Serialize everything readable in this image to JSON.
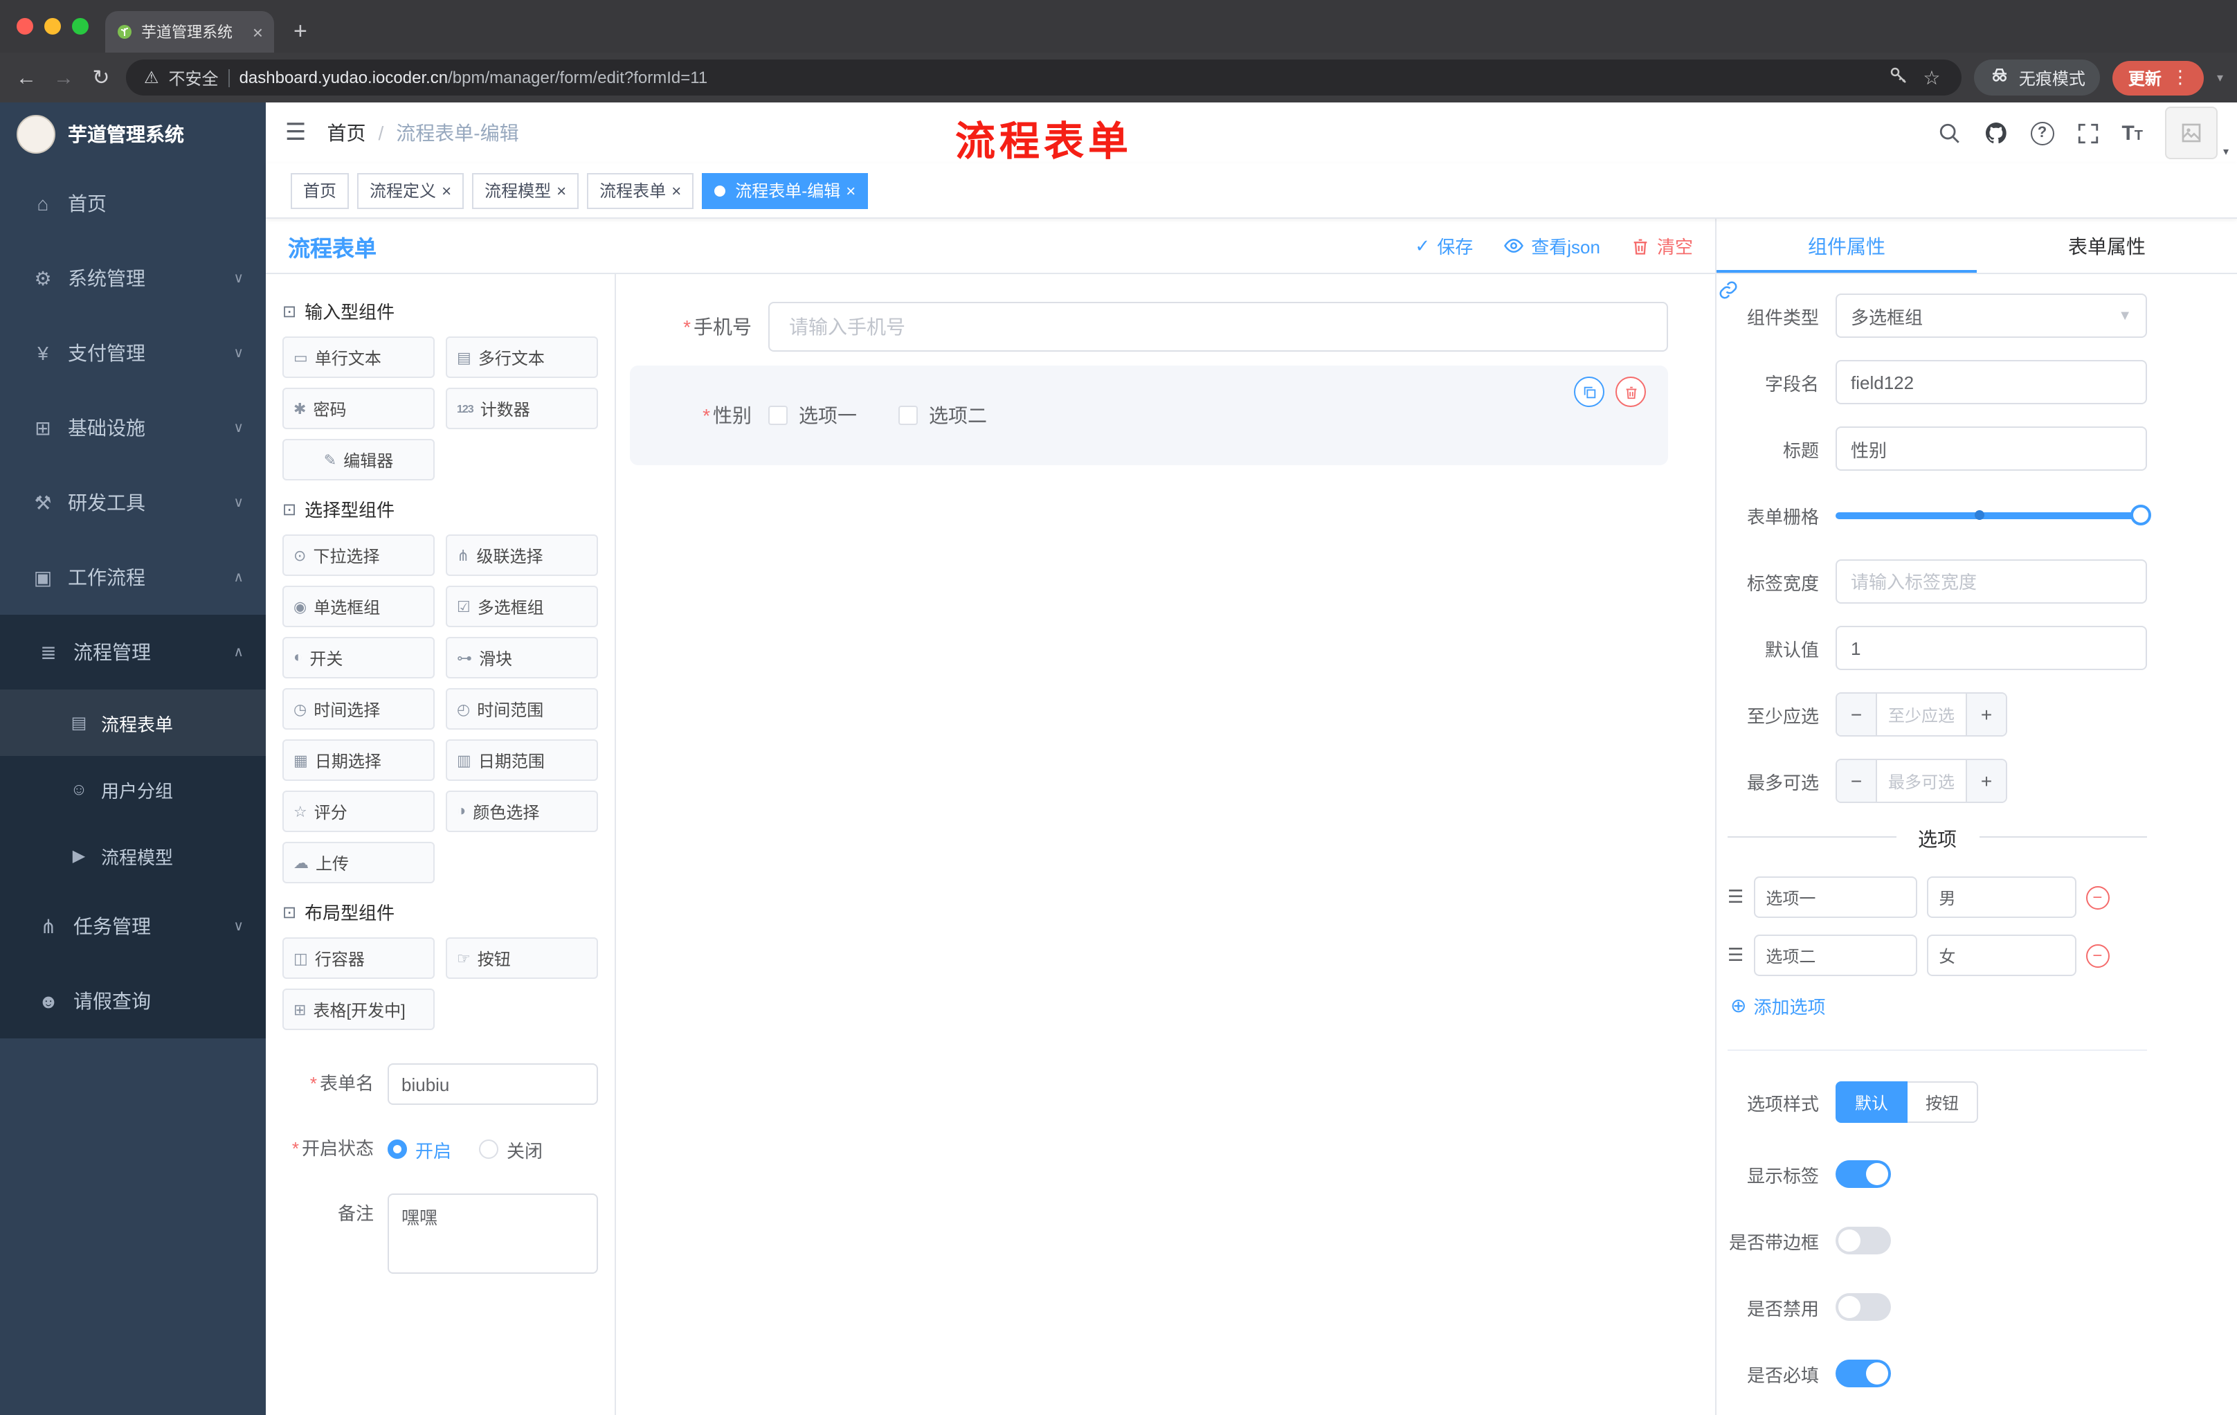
{
  "colors": {
    "accent": "#409eff",
    "danger": "#f56c6c",
    "annotation_red": "#f51f15",
    "sidebar_bg": "#304156",
    "submenu_bg": "#1f2d3d",
    "tag_active": "#409eff",
    "update_pill": "#d95b4e"
  },
  "ui": {
    "required_mark": "*",
    "hamburger": "☰",
    "back": "←",
    "forward": "→",
    "reload": "↻",
    "warning": "⚠",
    "star": "☆",
    "new_tab": "+",
    "kebab": "⋮",
    "caret_down": "▾",
    "close": "×",
    "check": "✓",
    "help": "?",
    "font_icon": "T",
    "add": "⊕",
    "drag": "☰",
    "select_caret": "▼",
    "minus": "−",
    "plus": "+",
    "section_icon": "⊡"
  },
  "browser": {
    "tab_title": "芋道管理系统",
    "security_label": "不安全",
    "url_domain": "dashboard.yudao.iocoder.cn",
    "url_path": "/bpm/manager/form/edit?formId=11",
    "incognito_label": "无痕模式",
    "update_label": "更新"
  },
  "sidebar": {
    "logo": "芋道管理系统",
    "menu": [
      {
        "icon": "⌂",
        "label": "首页"
      },
      {
        "icon": "⚙",
        "label": "系统管理",
        "chevron": "∨"
      },
      {
        "icon": "¥",
        "label": "支付管理",
        "chevron": "∨"
      },
      {
        "icon": "⊞",
        "label": "基础设施",
        "chevron": "∨"
      },
      {
        "icon": "⚒",
        "label": "研发工具",
        "chevron": "∨"
      },
      {
        "icon": "▣",
        "label": "工作流程",
        "chevron": "∧"
      }
    ],
    "submenu": {
      "group": {
        "icon": "≣",
        "label": "流程管理",
        "chevron": "∧"
      },
      "leaves": [
        {
          "icon": "▤",
          "label": "流程表单",
          "active": true
        },
        {
          "icon": "☺",
          "label": "用户分组"
        },
        {
          "icon": "▶",
          "label": "流程模型"
        }
      ],
      "siblings": [
        {
          "icon": "⋔",
          "label": "任务管理",
          "chevron": "∨"
        },
        {
          "icon": "☻",
          "label": "请假查询"
        }
      ]
    }
  },
  "header": {
    "breadcrumb": {
      "home": "首页",
      "sep": "/",
      "current": "流程表单-编辑"
    },
    "annotation": "流程表单"
  },
  "tags": {
    "items": [
      {
        "label": "首页",
        "closable": false,
        "active": false
      },
      {
        "label": "流程定义",
        "closable": true,
        "active": false
      },
      {
        "label": "流程模型",
        "closable": true,
        "active": false
      },
      {
        "label": "流程表单",
        "closable": true,
        "active": false
      },
      {
        "label": "流程表单-编辑",
        "closable": true,
        "active": true
      }
    ]
  },
  "editor": {
    "title": "流程表单",
    "actions": {
      "save": "保存",
      "view_json": "查看json",
      "clear": "清空"
    },
    "palette": {
      "sections": [
        {
          "title": "输入型组件",
          "items": [
            {
              "icon": "▭",
              "label": "单行文本"
            },
            {
              "icon": "▤",
              "label": "多行文本"
            },
            {
              "icon": "✱",
              "label": "密码"
            },
            {
              "icon": "123",
              "label": "计数器"
            },
            {
              "icon": "✎",
              "label": "编辑器"
            }
          ]
        },
        {
          "title": "选择型组件",
          "items": [
            {
              "icon": "⊙",
              "label": "下拉选择"
            },
            {
              "icon": "⋔",
              "label": "级联选择"
            },
            {
              "icon": "◉",
              "label": "单选框组"
            },
            {
              "icon": "☑",
              "label": "多选框组"
            },
            {
              "icon": "◐",
              "label": "开关"
            },
            {
              "icon": "⊶",
              "label": "滑块"
            },
            {
              "icon": "◷",
              "label": "时间选择"
            },
            {
              "icon": "◴",
              "label": "时间范围"
            },
            {
              "icon": "▦",
              "label": "日期选择"
            },
            {
              "icon": "▥",
              "label": "日期范围"
            },
            {
              "icon": "☆",
              "label": "评分"
            },
            {
              "icon": "◑",
              "label": "颜色选择"
            },
            {
              "icon": "☁",
              "label": "上传"
            }
          ]
        },
        {
          "title": "布局型组件",
          "items": [
            {
              "icon": "◫",
              "label": "行容器"
            },
            {
              "icon": "☞",
              "label": "按钮"
            },
            {
              "icon": "⊞",
              "label": "表格[开发中]"
            }
          ]
        }
      ]
    },
    "meta": {
      "name_label": "表单名",
      "name_value": "biubiu",
      "status_label": "开启状态",
      "status_on": "开启",
      "status_off": "关闭",
      "status_selected": "开启",
      "remark_label": "备注",
      "remark_value": "嘿嘿"
    },
    "canvas": {
      "phone": {
        "label": "手机号",
        "placeholder": "请输入手机号",
        "required": true
      },
      "gender": {
        "label": "性别",
        "required": true,
        "opt1": "选项一",
        "opt2": "选项二",
        "selected_component": true
      }
    }
  },
  "props": {
    "tab_component": "组件属性",
    "tab_form": "表单属性",
    "active_tab": "组件属性",
    "component_type": {
      "label": "组件类型",
      "value": "多选框组"
    },
    "field_name": {
      "label": "字段名",
      "value": "field122"
    },
    "title": {
      "label": "标题",
      "value": "性别"
    },
    "grid": {
      "label": "表单栅格"
    },
    "label_width": {
      "label": "标签宽度",
      "placeholder": "请输入标签宽度"
    },
    "default_value": {
      "label": "默认值",
      "value": "1"
    },
    "min_select": {
      "label": "至少应选",
      "placeholder": "至少应选"
    },
    "max_select": {
      "label": "最多可选",
      "placeholder": "最多可选"
    },
    "options_divider": "选项",
    "options": [
      {
        "label": "选项一",
        "value": "男"
      },
      {
        "label": "选项二",
        "value": "女"
      }
    ],
    "add_option": "添加选项",
    "style": {
      "label": "选项样式",
      "default": "默认",
      "button": "按钮",
      "selected": "默认"
    },
    "switches": [
      {
        "label": "显示标签",
        "on": true
      },
      {
        "label": "是否带边框",
        "on": false
      },
      {
        "label": "是否禁用",
        "on": false
      },
      {
        "label": "是否必填",
        "on": true
      }
    ]
  }
}
